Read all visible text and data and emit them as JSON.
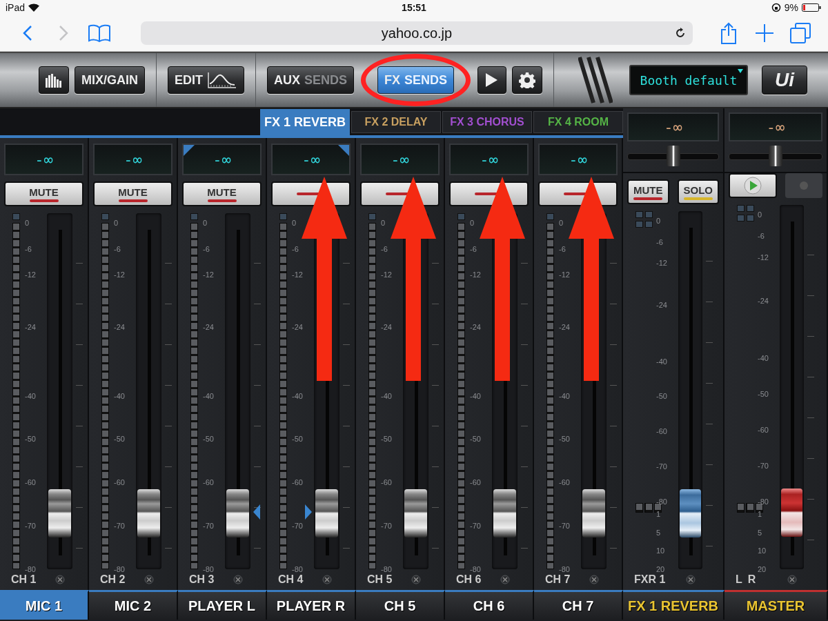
{
  "status_bar": {
    "device": "iPad",
    "time": "15:51",
    "battery": "9%"
  },
  "browser": {
    "url": "yahoo.co.jp"
  },
  "toolbar": {
    "groups": [
      [
        {
          "kind": "meters"
        },
        {
          "kind": "text",
          "label": "MIX/GAIN"
        }
      ],
      [
        {
          "kind": "edit",
          "label": "EDIT"
        }
      ],
      [
        {
          "kind": "sends",
          "label": "AUX",
          "suffix": "SENDS",
          "selected": false,
          "circled": false
        },
        {
          "kind": "sends",
          "label": "FX",
          "suffix": "SENDS",
          "selected": true,
          "circled": true
        },
        {
          "kind": "play"
        },
        {
          "kind": "settings"
        }
      ]
    ],
    "preset": "Booth default",
    "logo": "Ui"
  },
  "fx_tabs": [
    {
      "label": "FX 1 REVERB",
      "selected": true
    },
    {
      "label": "FX 2 DELAY",
      "color": "#c8a060",
      "selected": false
    },
    {
      "label": "FX 3 CHORUS",
      "color": "#a24fd0",
      "selected": false
    },
    {
      "label": "FX 4 ROOM",
      "color": "#55b446",
      "selected": false
    }
  ],
  "channels": [
    {
      "reading": "-∞",
      "mute": "MUTE",
      "strip": "CH 1",
      "name": "MIC 1",
      "selected": true,
      "level": 0.1,
      "arrow": false,
      "linked": false,
      "scale": [
        "0",
        "-6",
        "-12",
        "-24",
        "-40",
        "-50",
        "-60",
        "-70",
        "-80"
      ]
    },
    {
      "reading": "-∞",
      "mute": "MUTE",
      "strip": "CH 2",
      "name": "MIC 2",
      "selected": false,
      "level": 0.1,
      "arrow": false,
      "linked": false,
      "scale": [
        "0",
        "-6",
        "-12",
        "-24",
        "-40",
        "-50",
        "-60",
        "-70",
        "-80"
      ]
    },
    {
      "reading": "-∞",
      "mute": "MUTE",
      "strip": "CH 3",
      "name": "PLAYER L",
      "selected": false,
      "level": 0.1,
      "arrow": false,
      "linked": true,
      "scale": [
        "0",
        "-6",
        "-12",
        "-24",
        "-40",
        "-50",
        "-60",
        "-70",
        "-80"
      ]
    },
    {
      "reading": "-∞",
      "strip": "CH 4",
      "name": "PLAYER R",
      "selected": false,
      "level": 0.1,
      "arrow": true,
      "linked": true,
      "scale": [
        "0",
        "-6",
        "-12",
        "-24",
        "-40",
        "-50",
        "-60",
        "-70",
        "-80"
      ]
    },
    {
      "reading": "-∞",
      "strip": "CH 5",
      "name": "CH 5",
      "selected": false,
      "level": 0.1,
      "arrow": true,
      "linked": false,
      "scale": [
        "0",
        "-6",
        "-12",
        "-24",
        "-40",
        "-50",
        "-60",
        "-70",
        "-80"
      ]
    },
    {
      "reading": "-∞",
      "strip": "CH 6",
      "name": "CH 6",
      "selected": false,
      "level": 0.1,
      "arrow": true,
      "linked": false,
      "scale": [
        "0",
        "-6",
        "-12",
        "-24",
        "-40",
        "-50",
        "-60",
        "-70",
        "-80"
      ]
    },
    {
      "reading": "-∞",
      "strip": "CH 7",
      "name": "CH 7",
      "selected": false,
      "level": 0.1,
      "arrow": true,
      "linked": false,
      "scale": [
        "0",
        "-6",
        "-12",
        "-24",
        "-40",
        "-50",
        "-60",
        "-70",
        "-80"
      ]
    }
  ],
  "fx_return": {
    "reading": "-∞",
    "pan": {
      "level": 0.5
    },
    "mute": "MUTE",
    "solo": "SOLO",
    "strip": "FXR 1",
    "name": "FX 1 REVERB",
    "level": 0.1,
    "scale_upper": [
      "0",
      "-6",
      "-12",
      "-24",
      "-40",
      "-50",
      "-60",
      "-70",
      "-80"
    ],
    "scale_lower": [
      "1",
      "5",
      "10",
      "20"
    ]
  },
  "master": {
    "reading": "-∞",
    "balance": {
      "level": 0.5
    },
    "left": "L",
    "right": "R",
    "name": "MASTER",
    "level": 0.1,
    "record_enabled": false,
    "scale_upper": [
      "0",
      "-6",
      "-12",
      "-24",
      "-40",
      "-50",
      "-60",
      "-70",
      "-80"
    ],
    "scale_lower": [
      "1",
      "5",
      "10",
      "20"
    ]
  }
}
